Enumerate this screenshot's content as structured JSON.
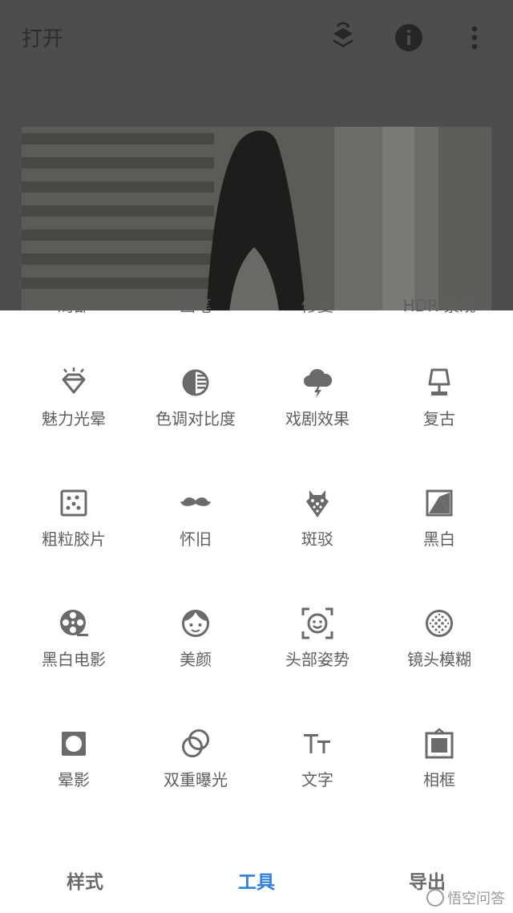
{
  "header": {
    "title": "打开",
    "icons": [
      "layers-sync-icon",
      "info-icon",
      "more-vert-icon"
    ]
  },
  "partial_row_labels": [
    "局部",
    "画笔",
    "修复",
    "HDR 景观"
  ],
  "tools": [
    {
      "label": "魅力光晕",
      "icon": "glamour-glow-icon"
    },
    {
      "label": "色调对比度",
      "icon": "tonal-contrast-icon"
    },
    {
      "label": "戏剧效果",
      "icon": "drama-icon"
    },
    {
      "label": "复古",
      "icon": "vintage-lamp-icon"
    },
    {
      "label": "粗粒胶片",
      "icon": "grainy-film-icon"
    },
    {
      "label": "怀旧",
      "icon": "retrolux-mustache-icon"
    },
    {
      "label": "斑驳",
      "icon": "grunge-icon"
    },
    {
      "label": "黑白",
      "icon": "black-white-icon"
    },
    {
      "label": "黑白电影",
      "icon": "noir-film-reel-icon"
    },
    {
      "label": "美颜",
      "icon": "portrait-face-icon"
    },
    {
      "label": "头部姿势",
      "icon": "head-pose-icon"
    },
    {
      "label": "镜头模糊",
      "icon": "lens-blur-icon"
    },
    {
      "label": "晕影",
      "icon": "vignette-icon"
    },
    {
      "label": "双重曝光",
      "icon": "double-exposure-icon"
    },
    {
      "label": "文字",
      "icon": "text-icon"
    },
    {
      "label": "相框",
      "icon": "frames-icon"
    }
  ],
  "bottom_nav": {
    "styles": "样式",
    "tools": "工具",
    "export": "导出",
    "active": "tools"
  },
  "watermark": "悟空问答",
  "colors": {
    "accent": "#2f80d8",
    "icon": "#6a6a6a",
    "label": "#5f5f5f",
    "overlay": "#4d4d4d"
  }
}
